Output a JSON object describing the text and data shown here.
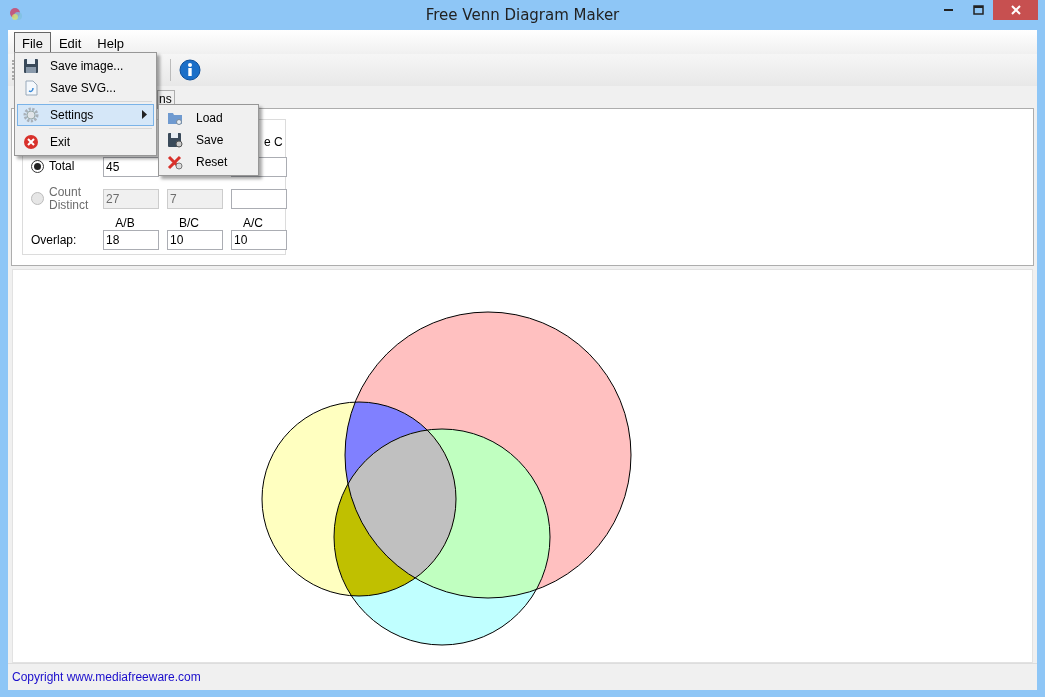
{
  "window": {
    "title": "Free Venn Diagram Maker"
  },
  "menu_bar": [
    {
      "label": "File",
      "selected": true
    },
    {
      "label": "Edit",
      "selected": false
    },
    {
      "label": "Help",
      "selected": false
    }
  ],
  "file_menu": [
    {
      "kind": "item",
      "label": "Save image...",
      "selected": false
    },
    {
      "kind": "item",
      "label": "Save SVG...",
      "selected": false
    },
    {
      "kind": "separator"
    },
    {
      "kind": "submenu",
      "label": "Settings",
      "selected": true
    },
    {
      "kind": "separator"
    },
    {
      "kind": "item",
      "label": "Exit",
      "selected": false
    }
  ],
  "settings_submenu": [
    {
      "label": "Load"
    },
    {
      "label": "Save"
    },
    {
      "label": "Reset"
    }
  ],
  "tab": {
    "label": "ns"
  },
  "form": {
    "heading": "e C",
    "rows": [
      {
        "label": "Total",
        "selected": true,
        "disabled": false,
        "values": [
          "45"
        ]
      },
      {
        "label": "Count Distinct",
        "selected": false,
        "disabled": true,
        "values": [
          "27",
          "7"
        ]
      }
    ],
    "overlap": {
      "label": "Overlap:",
      "columns": [
        "A/B",
        "B/C",
        "A/C"
      ],
      "values": [
        "18",
        "10",
        "10"
      ]
    }
  },
  "status_bar": {
    "text": "Copyright www.mediafreeware.com"
  }
}
